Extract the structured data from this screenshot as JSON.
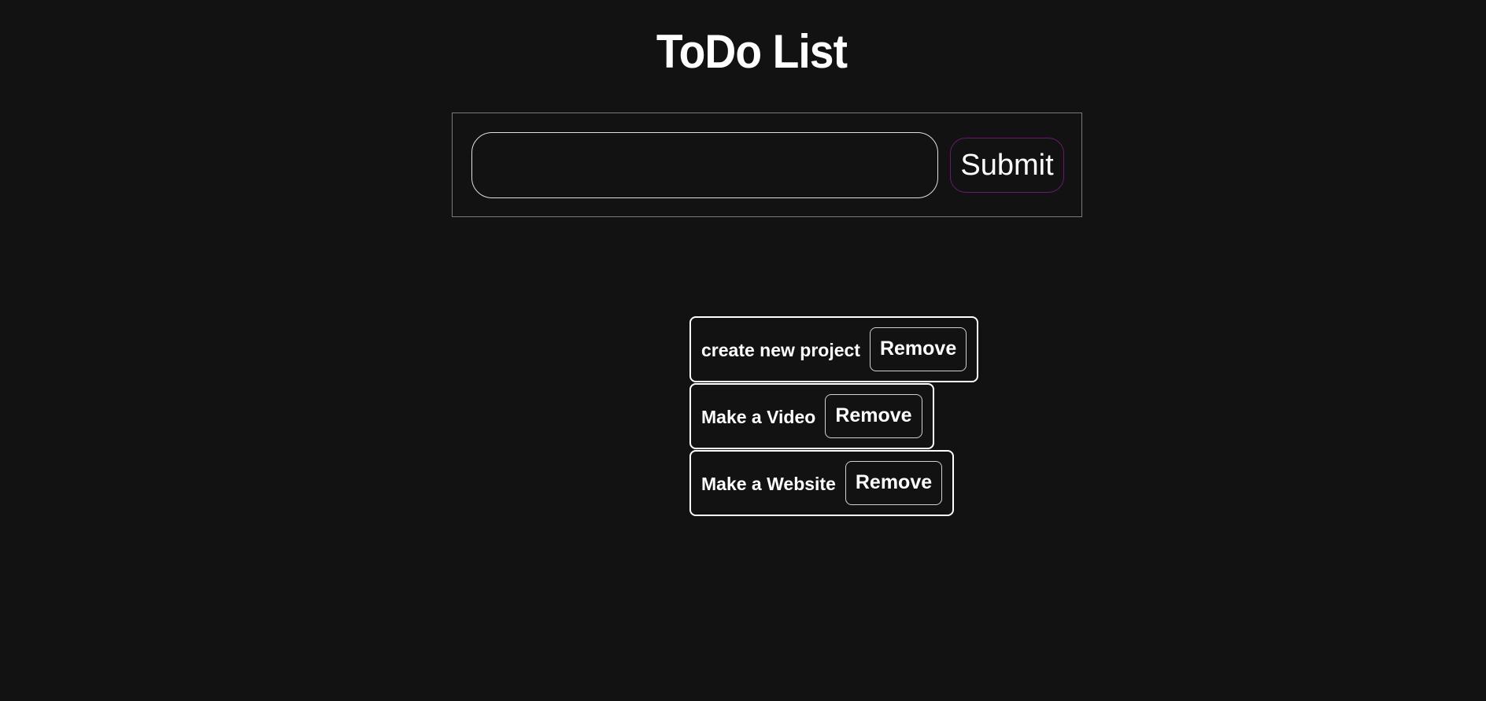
{
  "header": {
    "title": "ToDo List"
  },
  "form": {
    "input_value": "",
    "input_placeholder": "",
    "submit_label": "Submit"
  },
  "todos": [
    {
      "text": "create new project",
      "remove_label": "Remove"
    },
    {
      "text": "Make a Video",
      "remove_label": "Remove"
    },
    {
      "text": "Make a Website",
      "remove_label": "Remove"
    }
  ],
  "colors": {
    "background": "#121212",
    "text": "#ffffff",
    "submit_border": "#6a1a6a",
    "form_border": "#7a7a7a"
  }
}
